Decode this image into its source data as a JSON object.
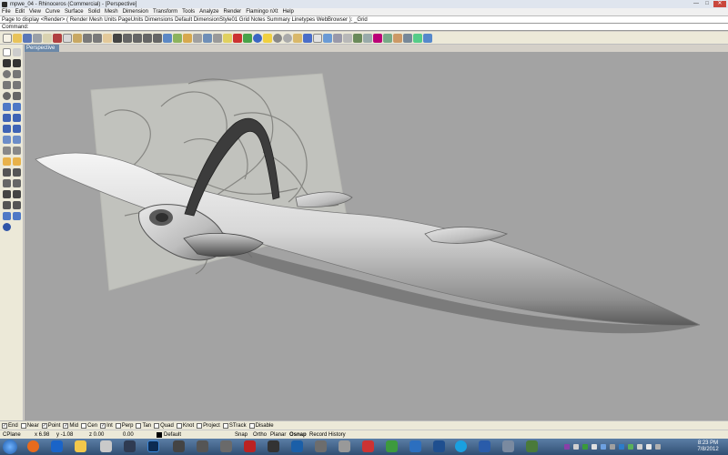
{
  "window": {
    "title": "mpwe_04 - Rhinoceros (Commercial) - [Perspective]",
    "min_label": "—",
    "max_label": "□",
    "close_label": "✕"
  },
  "menu": [
    "File",
    "Edit",
    "View",
    "Curve",
    "Surface",
    "Solid",
    "Mesh",
    "Dimension",
    "Transform",
    "Tools",
    "Analyze",
    "Render",
    "Flamingo nXt",
    "Help"
  ],
  "command_history": "Page to display <Render> ( Render  Mesh  Units  PageUnits  Dimensions  Default  DimensionStyle01  Grid  Notes  Summary  Linetypes  WebBrowser ): _Grid",
  "command": {
    "label": "Command:",
    "value": ""
  },
  "viewport": {
    "tab_label": "Perspective"
  },
  "osnaps": [
    {
      "label": "End",
      "checked": true
    },
    {
      "label": "Near",
      "checked": false
    },
    {
      "label": "Point",
      "checked": true
    },
    {
      "label": "Mid",
      "checked": true
    },
    {
      "label": "Cen",
      "checked": false
    },
    {
      "label": "Int",
      "checked": true
    },
    {
      "label": "Perp",
      "checked": false
    },
    {
      "label": "Tan",
      "checked": false
    },
    {
      "label": "Quad",
      "checked": false
    },
    {
      "label": "Knot",
      "checked": false
    },
    {
      "label": "Project",
      "checked": false
    },
    {
      "label": "STrack",
      "checked": false
    },
    {
      "label": "Disable",
      "checked": false
    }
  ],
  "status": {
    "cplane": "CPlane",
    "x": "x 6.98",
    "y": "y -1.08",
    "z": "z 0.00",
    "w": "0.00",
    "layer": "Default",
    "snap": "Snap",
    "ortho": "Ortho",
    "planar": "Planar",
    "osnap": "Osnap",
    "history": "Record History"
  },
  "taskbar": {
    "time": "8:23 PM",
    "date": "7/8/2012"
  },
  "colors": {
    "viewport_bg": "#a3a3a3",
    "tab_active": "#6b88a8",
    "close_button": "#c9473d"
  }
}
